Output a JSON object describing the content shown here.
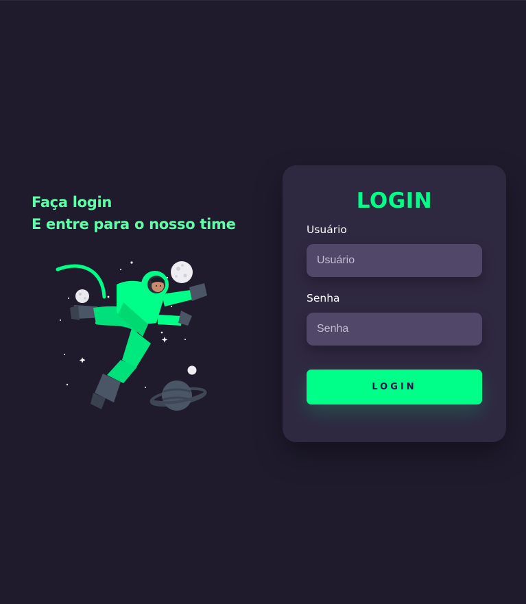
{
  "hero": {
    "line1": "Faça login",
    "line2": "E entre para o nosso time"
  },
  "illustration": {
    "subject": "astronaut-floating-in-space"
  },
  "login_card": {
    "title": "LOGIN",
    "username": {
      "label": "Usuário",
      "placeholder": "Usuário",
      "value": ""
    },
    "password": {
      "label": "Senha",
      "placeholder": "Senha",
      "value": ""
    },
    "submit_label": "LOGIN"
  },
  "colors": {
    "background": "#1f1b2d",
    "card": "#2f2841",
    "input": "#514869",
    "accent": "#00ff88",
    "headline": "#5effa8",
    "button_text": "#2b134b"
  }
}
